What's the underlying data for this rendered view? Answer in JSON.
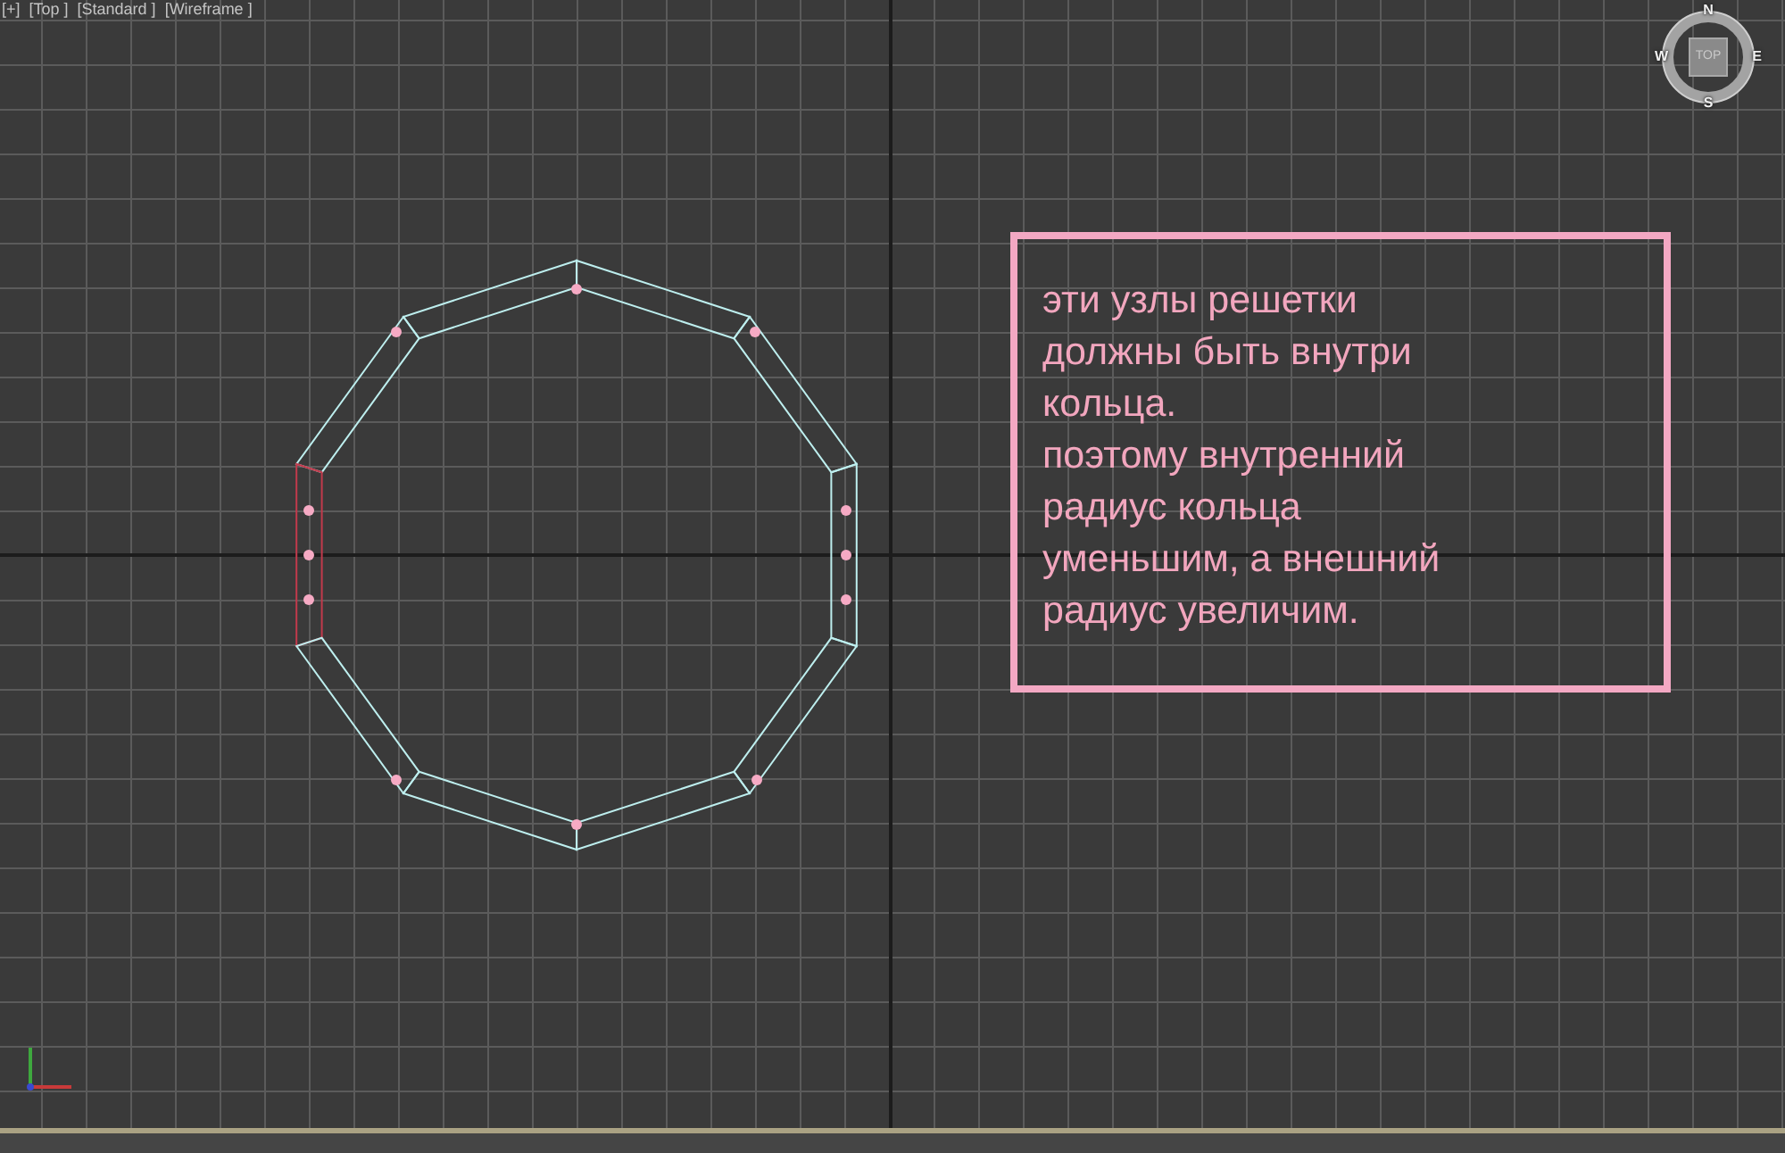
{
  "viewport": {
    "labels": [
      "[+]",
      "[Top ]",
      "[Standard ]",
      "[Wireframe ]"
    ]
  },
  "view_cube": {
    "face": "TOP",
    "compass": {
      "north": "N",
      "east": "E",
      "south": "S",
      "west": "W"
    }
  },
  "ring": {
    "segments": [
      {
        "selected": false
      },
      {
        "selected": false
      },
      {
        "selected": true
      },
      {
        "selected": false
      },
      {
        "selected": false
      },
      {
        "selected": false
      },
      {
        "selected": false
      },
      {
        "selected": false
      },
      {
        "selected": false
      },
      {
        "selected": false
      }
    ]
  },
  "note": {
    "paragraphs": [
      {
        "lines": [
          "эти узлы решетки",
          "должны быть внутри",
          "кольца."
        ]
      },
      {
        "lines": [
          "поэтому внутренний",
          "радиус кольца",
          "уменьшим, а внешний",
          "радиус увеличим."
        ]
      }
    ]
  }
}
